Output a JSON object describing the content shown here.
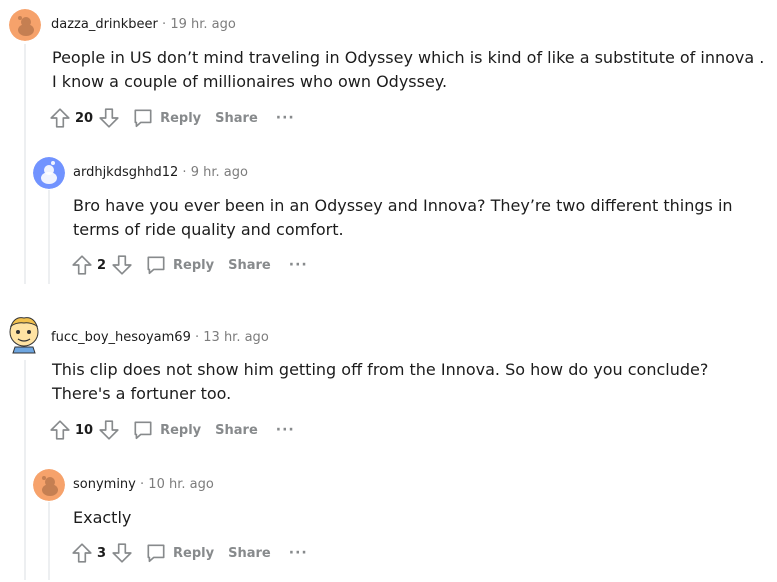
{
  "comments": [
    {
      "author": "dazza_drinkbeer",
      "time": "19 hr. ago",
      "body": "People in US don’t mind traveling in Odyssey which is kind of like a substitute of innova . I know a couple of millionaires who own Odyssey.",
      "votes": "20",
      "reply_label": "Reply",
      "share_label": "Share",
      "more_label": "···",
      "avatar_color": "#f6a26b"
    },
    {
      "author": "ardhjkdsghhd12",
      "time": "9 hr. ago",
      "body": "Bro have you ever been in an Odyssey and Innova? They’re two different things in terms of ride quality and comfort.",
      "votes": "2",
      "reply_label": "Reply",
      "share_label": "Share",
      "more_label": "···",
      "avatar_color": "#7193ff"
    },
    {
      "author": "fucc_boy_hesoyam69",
      "time": "13 hr. ago",
      "body": "This clip does not show him getting off from the Innova. So how do you conclude? There's a fortuner too.",
      "votes": "10",
      "reply_label": "Reply",
      "share_label": "Share",
      "more_label": "···",
      "avatar_color": "#ffd635"
    },
    {
      "author": "sonyminy",
      "time": "10 hr. ago",
      "body": "Exactly",
      "votes": "3",
      "reply_label": "Reply",
      "share_label": "Share",
      "more_label": "···",
      "avatar_color": "#f6a26b"
    }
  ],
  "separator": "·"
}
